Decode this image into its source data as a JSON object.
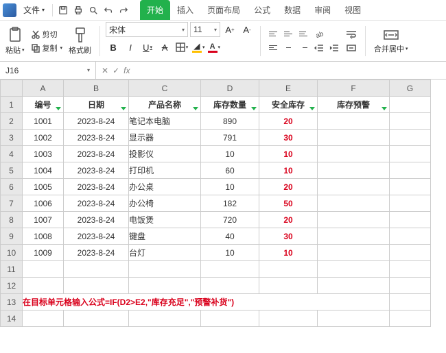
{
  "menu": {
    "file": "文件",
    "tabs": [
      "开始",
      "插入",
      "页面布局",
      "公式",
      "数据",
      "审阅",
      "视图"
    ],
    "activeTab": 0
  },
  "ribbon": {
    "paste": "粘贴",
    "cut": "剪切",
    "copy": "复制",
    "formatPainter": "格式刷",
    "fontName": "宋体",
    "fontSize": "11",
    "mergeCenter": "合并居中"
  },
  "namebox": "J16",
  "fx": "fx",
  "columns": [
    "A",
    "B",
    "C",
    "D",
    "E",
    "F",
    "G"
  ],
  "headers": [
    "编号",
    "日期",
    "产品名称",
    "库存数量",
    "安全库存",
    "库存预警"
  ],
  "rows": [
    {
      "id": "1001",
      "date": "2023-8-24",
      "name": "笔记本电脑",
      "qty": "890",
      "safe": "20"
    },
    {
      "id": "1002",
      "date": "2023-8-24",
      "name": "显示器",
      "qty": "791",
      "safe": "30"
    },
    {
      "id": "1003",
      "date": "2023-8-24",
      "name": "投影仪",
      "qty": "10",
      "safe": "10"
    },
    {
      "id": "1004",
      "date": "2023-8-24",
      "name": "打印机",
      "qty": "60",
      "safe": "10"
    },
    {
      "id": "1005",
      "date": "2023-8-24",
      "name": "办公桌",
      "qty": "10",
      "safe": "20"
    },
    {
      "id": "1006",
      "date": "2023-8-24",
      "name": "办公椅",
      "qty": "182",
      "safe": "50"
    },
    {
      "id": "1007",
      "date": "2023-8-24",
      "name": "电饭煲",
      "qty": "720",
      "safe": "20"
    },
    {
      "id": "1008",
      "date": "2023-8-24",
      "name": "键盘",
      "qty": "40",
      "safe": "30"
    },
    {
      "id": "1009",
      "date": "2023-8-24",
      "name": "台灯",
      "qty": "10",
      "safe": "10"
    }
  ],
  "note": "在目标单元格输入公式=IF(D2>E2,\"库存充足\",\"预警补货\")"
}
